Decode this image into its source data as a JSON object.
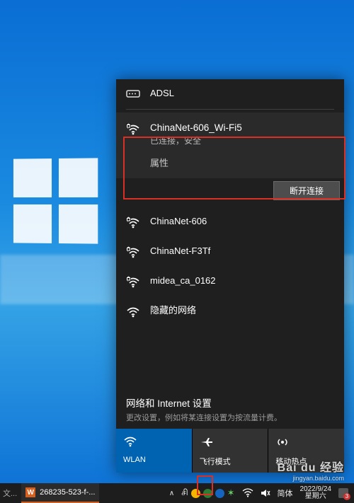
{
  "networks": {
    "adsl": {
      "name": "ADSL"
    },
    "connected": {
      "name": "ChinaNet-606_Wi-Fi5",
      "status": "已连接，安全",
      "properties_label": "属性",
      "disconnect_label": "断开连接"
    },
    "list": [
      {
        "name": "ChinaNet-606"
      },
      {
        "name": "ChinaNet-F3Tf"
      },
      {
        "name": "midea_ca_0162"
      },
      {
        "name": "隐藏的网络"
      }
    ]
  },
  "settings": {
    "title": "网络和 Internet 设置",
    "subtitle": "更改设置，例如将某连接设置为按流量计费。"
  },
  "tiles": {
    "wlan": "WLAN",
    "airplane": "飞行模式",
    "hotspot": "移动热点"
  },
  "taskbar": {
    "app_title": "268235-523-f-...",
    "ime_mode": "简体",
    "date": "2022/9/24",
    "weekday": "星期六",
    "notif_count": "3"
  },
  "watermark": {
    "brand": "Bai du 经验",
    "sub": "jingyan.baidu.com"
  }
}
